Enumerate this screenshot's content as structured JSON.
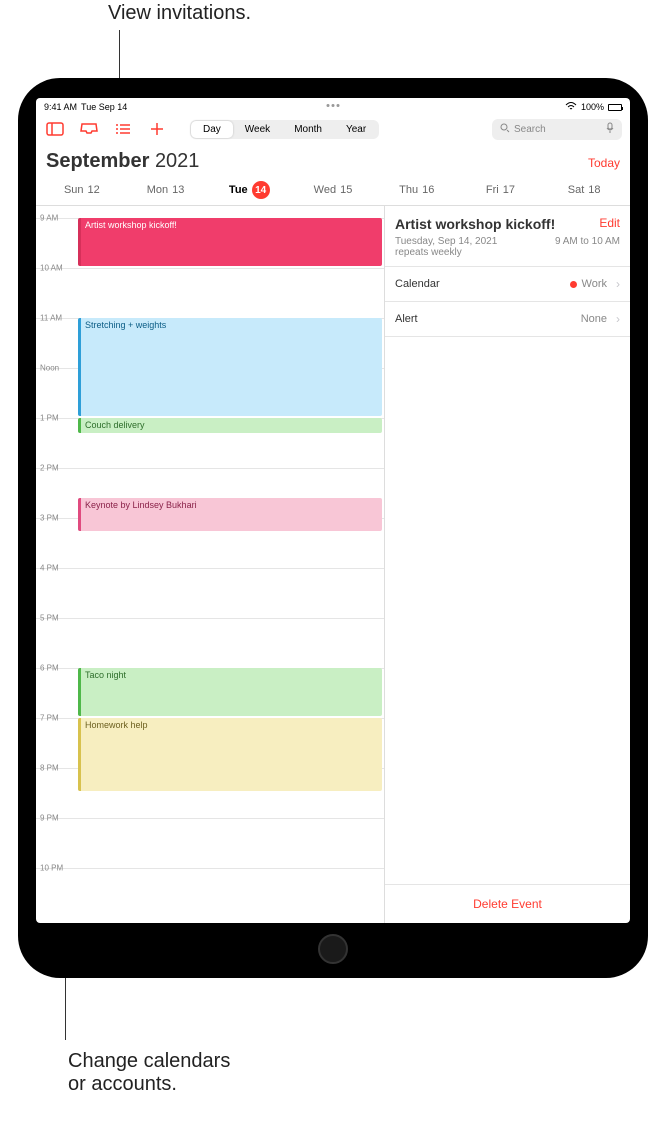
{
  "callouts": {
    "top": "View invitations.",
    "bottom": "Change calendars\nor accounts."
  },
  "status": {
    "time": "9:41 AM",
    "date": "Tue Sep 14",
    "battery": "100%",
    "wifi": "wifi"
  },
  "toolbar": {
    "segments": [
      "Day",
      "Week",
      "Month",
      "Year"
    ],
    "selected": "Day",
    "search_placeholder": "Search"
  },
  "header": {
    "month": "September",
    "year": "2021",
    "today_label": "Today"
  },
  "week": [
    {
      "label": "Sun",
      "num": "12"
    },
    {
      "label": "Mon",
      "num": "13"
    },
    {
      "label": "Tue",
      "num": "14",
      "today": true
    },
    {
      "label": "Wed",
      "num": "15"
    },
    {
      "label": "Thu",
      "num": "16"
    },
    {
      "label": "Fri",
      "num": "17"
    },
    {
      "label": "Sat",
      "num": "18"
    }
  ],
  "hours": [
    "9 AM",
    "10 AM",
    "11 AM",
    "Noon",
    "1 PM",
    "2 PM",
    "3 PM",
    "4 PM",
    "5 PM",
    "6 PM",
    "7 PM",
    "8 PM",
    "9 PM",
    "10 PM"
  ],
  "events": [
    {
      "title": "Artist workshop kickoff!",
      "start": 0,
      "dur": 1,
      "bg": "#f03d6b",
      "border": "#d6305a",
      "text": "#fff"
    },
    {
      "title": "Stretching + weights",
      "start": 2,
      "dur": 2,
      "bg": "#c7eafb",
      "border": "#2e9fd8",
      "text": "#0b5d86"
    },
    {
      "title": "Couch delivery",
      "start": 4,
      "dur": 0.33,
      "bg": "#c9efc4",
      "border": "#4fb84a",
      "text": "#2e6e2b"
    },
    {
      "title": "Keynote by Lindsey Bukhari",
      "start": 5.6,
      "dur": 0.7,
      "bg": "#f8c6d6",
      "border": "#e04b7f",
      "text": "#8a2249"
    },
    {
      "title": "Taco night",
      "start": 9,
      "dur": 1,
      "bg": "#c9efc4",
      "border": "#4fb84a",
      "text": "#2e6e2b"
    },
    {
      "title": "Homework help",
      "start": 10,
      "dur": 1.5,
      "bg": "#f7eec0",
      "border": "#d8c24e",
      "text": "#6e6120"
    }
  ],
  "detail": {
    "title": "Artist workshop kickoff!",
    "edit": "Edit",
    "date": "Tuesday, Sep 14, 2021",
    "repeats": "repeats weekly",
    "time": "9 AM to 10 AM",
    "rows": {
      "calendar_label": "Calendar",
      "calendar_value": "Work",
      "alert_label": "Alert",
      "alert_value": "None"
    },
    "delete": "Delete Event"
  }
}
